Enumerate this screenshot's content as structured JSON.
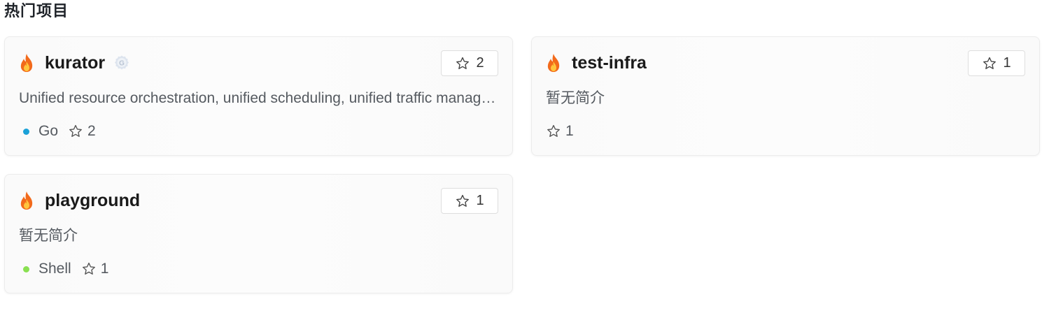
{
  "section": {
    "title": "热门项目"
  },
  "projects": [
    {
      "name": "kurator",
      "has_badge": true,
      "badge_letter": "G",
      "star_button_count": "2",
      "description": "Unified resource orchestration, unified scheduling, unified traffic management and unified telemetry for distributed cloud",
      "language": "Go",
      "language_color": "#1ba1d8",
      "stars": "2"
    },
    {
      "name": "test-infra",
      "has_badge": false,
      "star_button_count": "1",
      "description": "暂无简介",
      "language": "",
      "stars": "1"
    },
    {
      "name": "playground",
      "has_badge": false,
      "star_button_count": "1",
      "description": "暂无简介",
      "language": "Shell",
      "language_color": "#89e051",
      "stars": "1"
    }
  ],
  "icons": {
    "hot": "fire-icon",
    "star": "star-outline-icon",
    "badge": "gitee-badge-icon"
  },
  "colors": {
    "fire_outer": "#f26a1b",
    "fire_inner": "#ffc53d",
    "go": "#1ba1d8",
    "shell": "#89e051"
  }
}
